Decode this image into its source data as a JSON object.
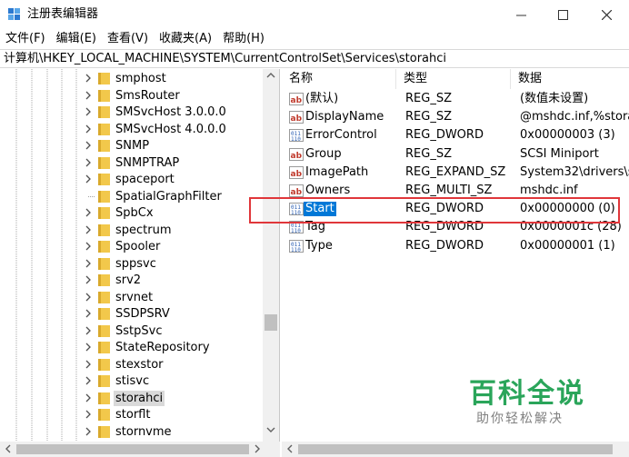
{
  "window": {
    "title": "注册表编辑器",
    "minimize": "—",
    "maximize": "☐",
    "close": "✕"
  },
  "menu": [
    "文件(F)",
    "编辑(E)",
    "查看(V)",
    "收藏夹(A)",
    "帮助(H)"
  ],
  "address": "计算机\\HKEY_LOCAL_MACHINE\\SYSTEM\\CurrentControlSet\\Services\\storahci",
  "tree": {
    "items": [
      {
        "label": "smphost",
        "chevron": true,
        "selected": false
      },
      {
        "label": "SmsRouter",
        "chevron": true,
        "selected": false
      },
      {
        "label": "SMSvcHost 3.0.0.0",
        "chevron": true,
        "selected": false
      },
      {
        "label": "SMSvcHost 4.0.0.0",
        "chevron": true,
        "selected": false
      },
      {
        "label": "SNMP",
        "chevron": true,
        "selected": false
      },
      {
        "label": "SNMPTRAP",
        "chevron": true,
        "selected": false
      },
      {
        "label": "spaceport",
        "chevron": true,
        "selected": false
      },
      {
        "label": "SpatialGraphFilter",
        "chevron": false,
        "selected": false
      },
      {
        "label": "SpbCx",
        "chevron": true,
        "selected": false
      },
      {
        "label": "spectrum",
        "chevron": true,
        "selected": false
      },
      {
        "label": "Spooler",
        "chevron": true,
        "selected": false
      },
      {
        "label": "sppsvc",
        "chevron": true,
        "selected": false
      },
      {
        "label": "srv2",
        "chevron": true,
        "selected": false
      },
      {
        "label": "srvnet",
        "chevron": true,
        "selected": false
      },
      {
        "label": "SSDPSRV",
        "chevron": true,
        "selected": false
      },
      {
        "label": "SstpSvc",
        "chevron": true,
        "selected": false
      },
      {
        "label": "StateRepository",
        "chevron": true,
        "selected": false
      },
      {
        "label": "stexstor",
        "chevron": true,
        "selected": false
      },
      {
        "label": "stisvc",
        "chevron": true,
        "selected": false
      },
      {
        "label": "storahci",
        "chevron": true,
        "selected": true
      },
      {
        "label": "storflt",
        "chevron": true,
        "selected": false
      },
      {
        "label": "stornvme",
        "chevron": true,
        "selected": false
      }
    ]
  },
  "values": {
    "headers": [
      "名称",
      "类型",
      "数据"
    ],
    "rows": [
      {
        "icon": "ab",
        "name": "(默认)",
        "type": "REG_SZ",
        "data": "(数值未设置)",
        "selected": false
      },
      {
        "icon": "ab",
        "name": "DisplayName",
        "type": "REG_SZ",
        "data": "@mshdc.inf,%stora",
        "selected": false
      },
      {
        "icon": "bin",
        "name": "ErrorControl",
        "type": "REG_DWORD",
        "data": "0x00000003 (3)",
        "selected": false
      },
      {
        "icon": "ab",
        "name": "Group",
        "type": "REG_SZ",
        "data": "SCSI Miniport",
        "selected": false
      },
      {
        "icon": "ab",
        "name": "ImagePath",
        "type": "REG_EXPAND_SZ",
        "data": "System32\\drivers\\s",
        "selected": false
      },
      {
        "icon": "ab",
        "name": "Owners",
        "type": "REG_MULTI_SZ",
        "data": "mshdc.inf",
        "selected": false
      },
      {
        "icon": "bin",
        "name": "Start",
        "type": "REG_DWORD",
        "data": "0x00000000 (0)",
        "selected": true
      },
      {
        "icon": "bin",
        "name": "Tag",
        "type": "REG_DWORD",
        "data": "0x0000001c (28)",
        "selected": false
      },
      {
        "icon": "bin",
        "name": "Type",
        "type": "REG_DWORD",
        "data": "0x00000001 (1)",
        "selected": false
      }
    ]
  },
  "watermark": {
    "title": "百科全说",
    "subtitle": "助你轻松解决"
  },
  "colors": {
    "selection": "#0078d7",
    "highlight_border": "#e0363a",
    "folder": "#f2c84b",
    "watermark_green": "#2aa55a"
  }
}
